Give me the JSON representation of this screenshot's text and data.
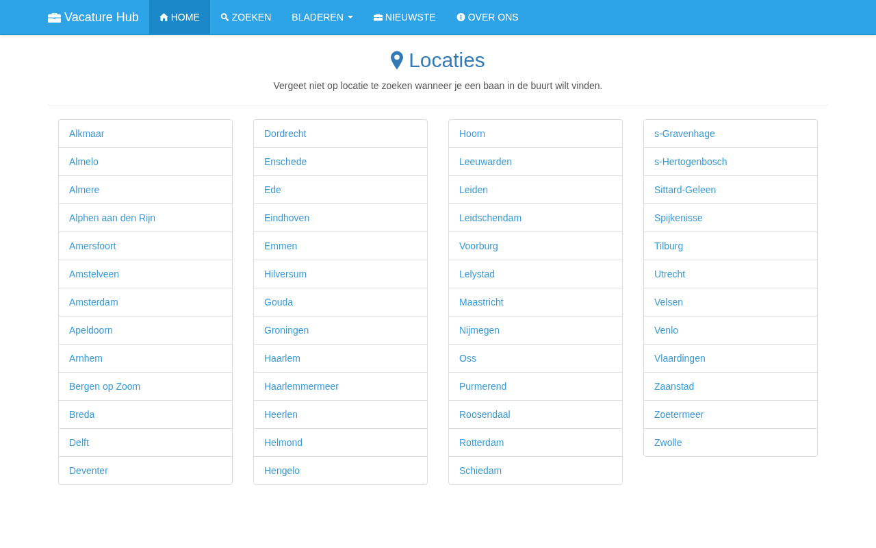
{
  "navbar": {
    "brand": "Vacature Hub",
    "items": [
      {
        "label": "HOME",
        "selected": true,
        "dropdown": false
      },
      {
        "label": "ZOEKEN",
        "selected": false,
        "dropdown": false
      },
      {
        "label": "BLADEREN",
        "selected": false,
        "dropdown": true
      },
      {
        "label": "NIEUWSTE",
        "selected": false,
        "dropdown": false
      },
      {
        "label": "OVER ONS",
        "selected": false,
        "dropdown": false
      }
    ]
  },
  "header": {
    "title": "Locaties",
    "subtitle": "Vergeet niet op locatie te zoeken wanneer je een baan in de buurt wilt vinden."
  },
  "location_columns": [
    [
      "Alkmaar",
      "Almelo",
      "Almere",
      "Alphen aan den Rijn",
      "Amersfoort",
      "Amstelveen",
      "Amsterdam",
      "Apeldoorn",
      "Arnhem",
      "Bergen op Zoom",
      "Breda",
      "Delft",
      "Deventer"
    ],
    [
      "Dordrecht",
      "Enschede",
      "Ede",
      "Eindhoven",
      "Emmen",
      "Hilversum",
      "Gouda",
      "Groningen",
      "Haarlem",
      "Haarlemmermeer",
      "Heerlen",
      "Helmond",
      "Hengelo"
    ],
    [
      "Hoorn",
      "Leeuwarden",
      "Leiden",
      "Leidschendam",
      "Voorburg",
      "Lelystad",
      "Maastricht",
      "Nijmegen",
      "Oss",
      "Purmerend",
      "Roosendaal",
      "Rotterdam",
      "Schiedam"
    ],
    [
      "s-Gravenhage",
      "s-Hertogenbosch",
      "Sittard-Geleen",
      "Spijkenisse",
      "Tilburg",
      "Utrecht",
      "Velsen",
      "Venlo",
      "Vlaardingen",
      "Zaanstad",
      "Zoetermeer",
      "Zwolle"
    ]
  ]
}
